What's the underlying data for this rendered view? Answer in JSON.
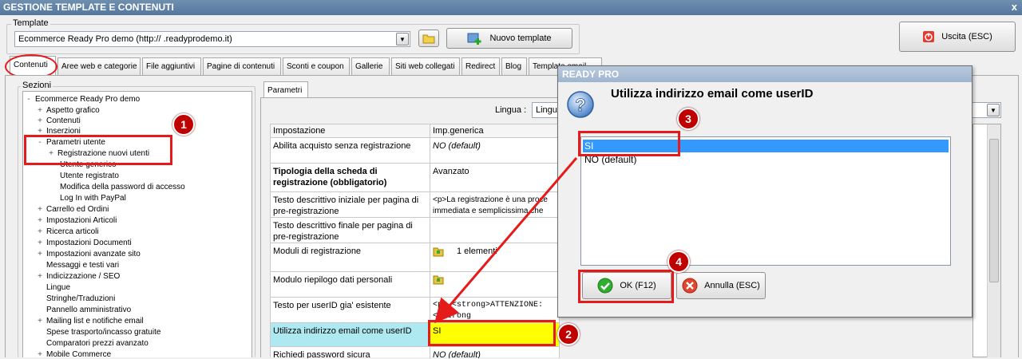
{
  "window": {
    "title": "GESTIONE TEMPLATE E CONTENUTI",
    "close": "x"
  },
  "template": {
    "group_label": "Template",
    "selected": "Ecommerce Ready Pro demo      (http://      .readyprodemo.it)",
    "new_button": "Nuovo template"
  },
  "exit_button": "Uscita (ESC)",
  "tabs": [
    "Contenuti",
    "Aree web e categorie",
    "File aggiuntivi",
    "Pagine di contenuti",
    "Sconti e coupon",
    "Gallerie",
    "Siti web collegati",
    "Redirect",
    "Blog",
    "Template email"
  ],
  "sections": {
    "label": "Sezioni",
    "items": [
      {
        "pm": "-",
        "label": "Ecommerce Ready Pro demo"
      },
      {
        "pm": "+",
        "label": "Aspetto grafico"
      },
      {
        "pm": "+",
        "label": "Contenuti"
      },
      {
        "pm": "+",
        "label": "Inserzioni"
      },
      {
        "pm": "-",
        "label": "Parametri utente"
      },
      {
        "pm": "+",
        "label": "Registrazione nuovi utenti"
      },
      {
        "pm": "",
        "label": "Utente generico"
      },
      {
        "pm": "",
        "label": "Utente registrato"
      },
      {
        "pm": "",
        "label": "Modifica della password di accesso"
      },
      {
        "pm": "",
        "label": "Log In with PayPal"
      },
      {
        "pm": "+",
        "label": "Carrello ed Ordini"
      },
      {
        "pm": "+",
        "label": "Impostazioni Articoli"
      },
      {
        "pm": "+",
        "label": "Ricerca articoli"
      },
      {
        "pm": "+",
        "label": "Impostazioni Documenti"
      },
      {
        "pm": "+",
        "label": "Impostazioni avanzate sito"
      },
      {
        "pm": "",
        "label": "Messaggi e testi vari"
      },
      {
        "pm": "+",
        "label": "Indicizzazione / SEO"
      },
      {
        "pm": "",
        "label": "Lingue"
      },
      {
        "pm": "",
        "label": "Stringhe/Traduzioni"
      },
      {
        "pm": "",
        "label": "Pannello amministrativo"
      },
      {
        "pm": "+",
        "label": "Mailing list e notifiche email"
      },
      {
        "pm": "",
        "label": "Spese trasporto/incasso gratuite"
      },
      {
        "pm": "",
        "label": "Comparatori prezzi avanzato"
      },
      {
        "pm": "+",
        "label": "Mobile Commerce"
      }
    ]
  },
  "params": {
    "tab": "Parametri",
    "lingua_label": "Lingua :",
    "lingua_value": "Lingua",
    "columns": [
      "Impostazione",
      "Imp.generica"
    ],
    "rows": [
      {
        "name": "Abilita acquisto senza registrazione",
        "value": "NO (default)",
        "bold": false,
        "italic": true
      },
      {
        "name": "Tipologia della scheda di registrazione (obbligatorio)",
        "value": "Avanzato",
        "bold": true,
        "italic": false
      },
      {
        "name": "Testo descrittivo iniziale per pagina di pre-registrazione",
        "value": "<p>La registrazione è una proce immediata e semplicissima che",
        "bold": false,
        "italic": false
      },
      {
        "name": "Testo descrittivo finale per pagina di pre-registrazione",
        "value": "",
        "bold": false,
        "italic": false
      },
      {
        "name": "Moduli di registrazione",
        "value": "1 elementi",
        "bold": false,
        "italic": false
      },
      {
        "name": "Modulo riepilogo dati personali",
        "value": "",
        "bold": false,
        "italic": false
      },
      {
        "name": "Testo per userID gia' esistente",
        "value": "<p> <strong>ATTENZIONE:</strong",
        "bold": false,
        "italic": false
      },
      {
        "name": "Utilizza indirizzo email come userID",
        "value": "SI",
        "bold": false,
        "italic": false
      },
      {
        "name": "Richiedi password sicura",
        "value": "NO (default)",
        "bold": false,
        "italic": true
      }
    ]
  },
  "dialog": {
    "title": "READY PRO",
    "question": "Utilizza indirizzo email come userID",
    "options": [
      "SI",
      "NO (default)"
    ],
    "selected_index": 0,
    "ok": "OK (F12)",
    "cancel": "Annulla (ESC)"
  },
  "callouts": [
    "1",
    "2",
    "3",
    "4"
  ],
  "colors": {
    "highlight": "#3399ff",
    "annotation": "#e51a1a",
    "yellow_cell": "#ffff00",
    "selected_name_cell": "#aee8f0"
  }
}
